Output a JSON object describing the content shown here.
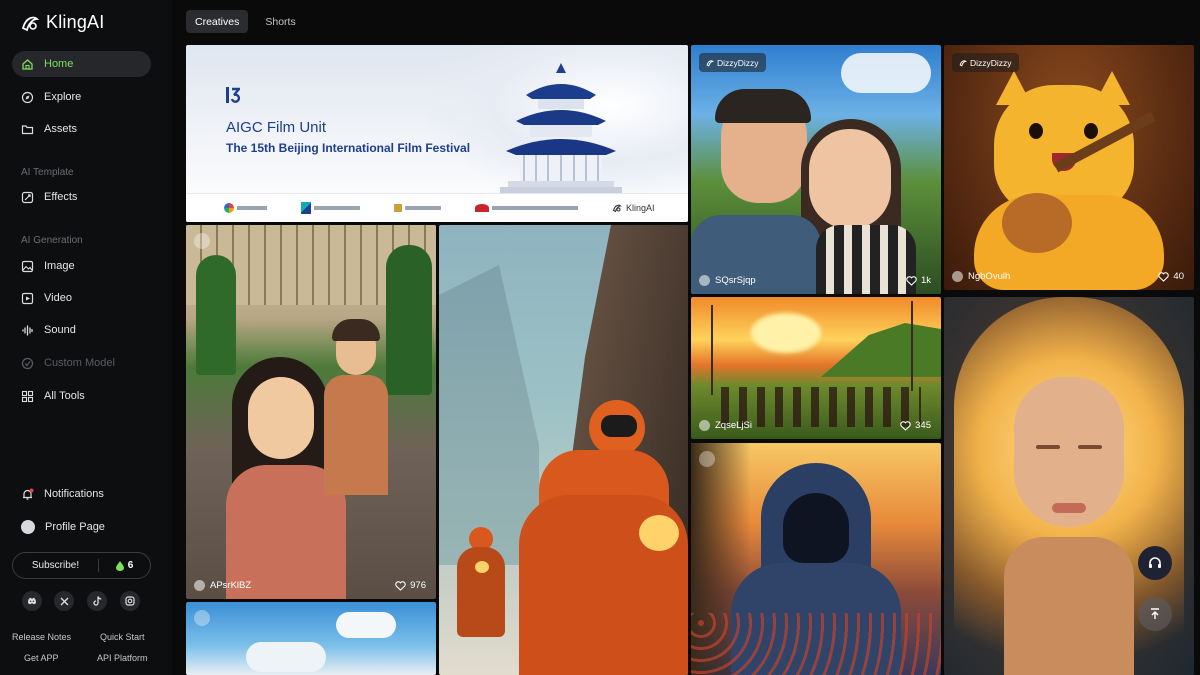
{
  "app": {
    "name": "KlingAI"
  },
  "sidebar": {
    "nav": [
      {
        "label": "Home",
        "icon": "home-icon"
      },
      {
        "label": "Explore",
        "icon": "compass-icon"
      },
      {
        "label": "Assets",
        "icon": "folder-icon"
      }
    ],
    "ai_template": {
      "label": "AI Template",
      "items": [
        {
          "label": "Effects",
          "icon": "effects-icon"
        }
      ]
    },
    "ai_generation": {
      "label": "AI Generation",
      "items": [
        {
          "label": "Image",
          "icon": "image-icon"
        },
        {
          "label": "Video",
          "icon": "video-icon"
        },
        {
          "label": "Sound",
          "icon": "sound-icon"
        },
        {
          "label": "Custom Model",
          "icon": "custom-model-icon"
        },
        {
          "label": "All Tools",
          "icon": "grid-icon"
        }
      ]
    },
    "notifications": "Notifications",
    "profile": "Profile Page",
    "subscribe": {
      "label": "Subscribe!",
      "credits": "6"
    },
    "social": [
      "discord-icon",
      "x-icon",
      "tiktok-icon",
      "instagram-icon"
    ],
    "footer_links": [
      "Release Notes",
      "Quick Start",
      "Get APP",
      "API Platform"
    ]
  },
  "tabs": [
    {
      "label": "Creatives",
      "active": true
    },
    {
      "label": "Shorts",
      "active": false
    }
  ],
  "banner": {
    "title": "AIGC Film Unit",
    "subtitle": "The 15th Beijing International Film Festival",
    "logo_text": "KlingAI"
  },
  "cards": {
    "couple_portrait": {
      "badge": "DizzyDizzy",
      "user": "SQsrSjqp",
      "likes": "1k"
    },
    "cat_guitar": {
      "badge": "DizzyDizzy",
      "user": "NgbOvulh",
      "likes": "40"
    },
    "anime_selfie": {
      "user": "APsrKlBZ",
      "likes": "976"
    },
    "sunset_riders": {
      "user": "ZqseLjSi",
      "likes": "345"
    }
  },
  "colors": {
    "accent": "#7de05a",
    "background": "#0a0a0b",
    "sidebar": "#0d0e10",
    "fab": "#1e2233"
  }
}
